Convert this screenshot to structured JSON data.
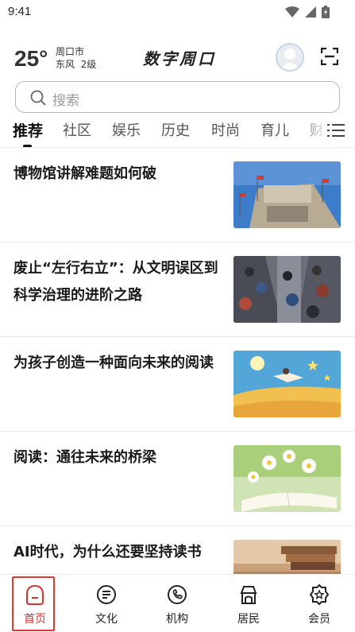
{
  "status_bar": {
    "time": "9:41"
  },
  "header": {
    "temperature": "25°",
    "city": "周口市",
    "wind": "东风  2级",
    "app_title": "数字周口"
  },
  "search": {
    "placeholder": "搜索"
  },
  "tabs": [
    "推荐",
    "社区",
    "娱乐",
    "历史",
    "时尚",
    "育儿",
    "财经"
  ],
  "active_tab": "推荐",
  "news": [
    {
      "title": "博物馆讲解难题如何破"
    },
    {
      "title": "废止“左行右立”：从文明误区到科学治理的进阶之路"
    },
    {
      "title": "为孩子创造一种面向未来的阅读"
    },
    {
      "title": "阅读：通往未来的桥梁"
    },
    {
      "title": "AI时代，为什么还要坚持读书"
    }
  ],
  "bottom_nav": [
    {
      "label": "首页",
      "icon": "home-icon",
      "active": true
    },
    {
      "label": "文化",
      "icon": "culture-icon",
      "active": false
    },
    {
      "label": "机构",
      "icon": "phone-icon",
      "active": false
    },
    {
      "label": "居民",
      "icon": "resident-icon",
      "active": false
    },
    {
      "label": "会员",
      "icon": "member-icon",
      "active": false
    }
  ],
  "colors": {
    "accent": "#d0352e",
    "text": "#1a1a1a",
    "muted": "#9a9a9a"
  }
}
